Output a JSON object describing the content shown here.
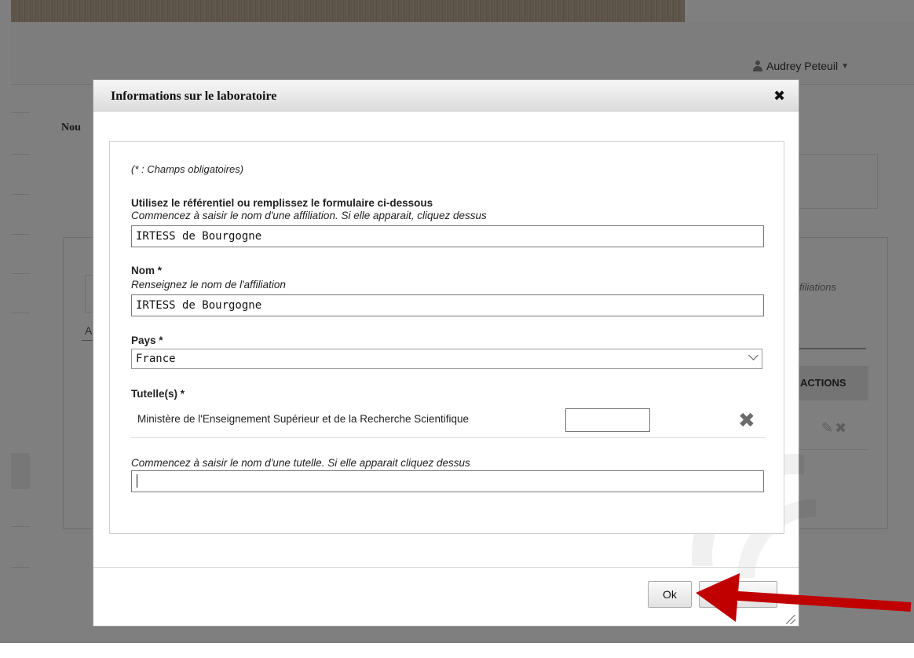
{
  "user": {
    "name": "Audrey Peteuil"
  },
  "background": {
    "heading_fragment": "Nou",
    "affiliations_fragment": "filiations",
    "actions_header": "ACTIONS",
    "tab_fragment": "A"
  },
  "modal": {
    "title": "Informations sur le laboratoire",
    "required_note": "(* : Champs obligatoires)",
    "referentiel": {
      "label": "Utilisez le référentiel ou remplissez le formulaire ci-dessous",
      "hint": "Commencez à saisir le nom d'une affiliation. Si elle apparait, cliquez dessus",
      "value": "IRTESS de Bourgogne"
    },
    "nom": {
      "label": "Nom *",
      "hint": "Renseignez le nom de l'affiliation",
      "value": "IRTESS de Bourgogne"
    },
    "pays": {
      "label": "Pays *",
      "selected": "France"
    },
    "tutelles": {
      "label": "Tutelle(s) *",
      "items": [
        {
          "name": "Ministère de l'Enseignement Supérieur et de la Recherche Scientifique",
          "value": ""
        }
      ],
      "search_hint": "Commencez à saisir le nom d'une tutelle. Si elle apparait cliquez dessus",
      "search_value": ""
    },
    "ok_label": "Ok",
    "second_button_label": "",
    "annotation_arrow_color": "#c00000"
  }
}
